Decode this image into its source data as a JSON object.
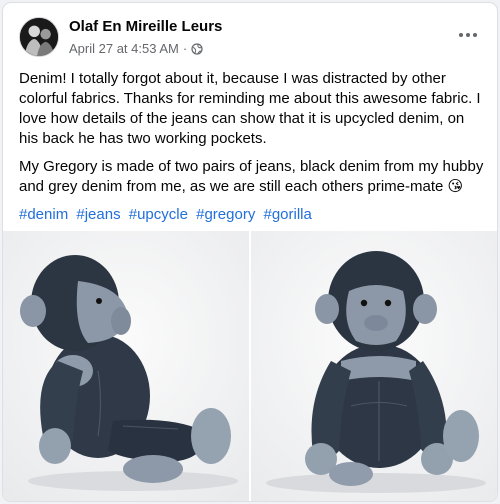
{
  "post": {
    "author": "Olaf En Mireille Leurs",
    "timestamp": "April 27 at 4:53 AM",
    "separator": "·",
    "privacy_icon": "globe-icon",
    "more_icon": "more-options-icon",
    "paragraphs": [
      "Denim! I totally forgot about it, because I was distracted by other colorful fabrics. Thanks for reminding me about this awesome fabric. I love how details of the jeans can show that it is upcycled denim, on his back he has two working pockets.",
      "My Gregory is made of two pairs of jeans, black denim from my hubby and grey denim from me, as we are still each others prime-mate 😘"
    ],
    "hashtags": [
      "#denim",
      "#jeans",
      "#upcycle",
      "#gregory",
      "#gorilla"
    ]
  },
  "photos": [
    {
      "subject": "denim-gorilla-plush-side-view"
    },
    {
      "subject": "denim-gorilla-plush-front-view"
    }
  ],
  "colors": {
    "link": "#216fdb",
    "text": "#050505",
    "secondary_text": "#65676b",
    "dark_denim": "#2e3846",
    "light_denim": "#8e9aa8"
  }
}
